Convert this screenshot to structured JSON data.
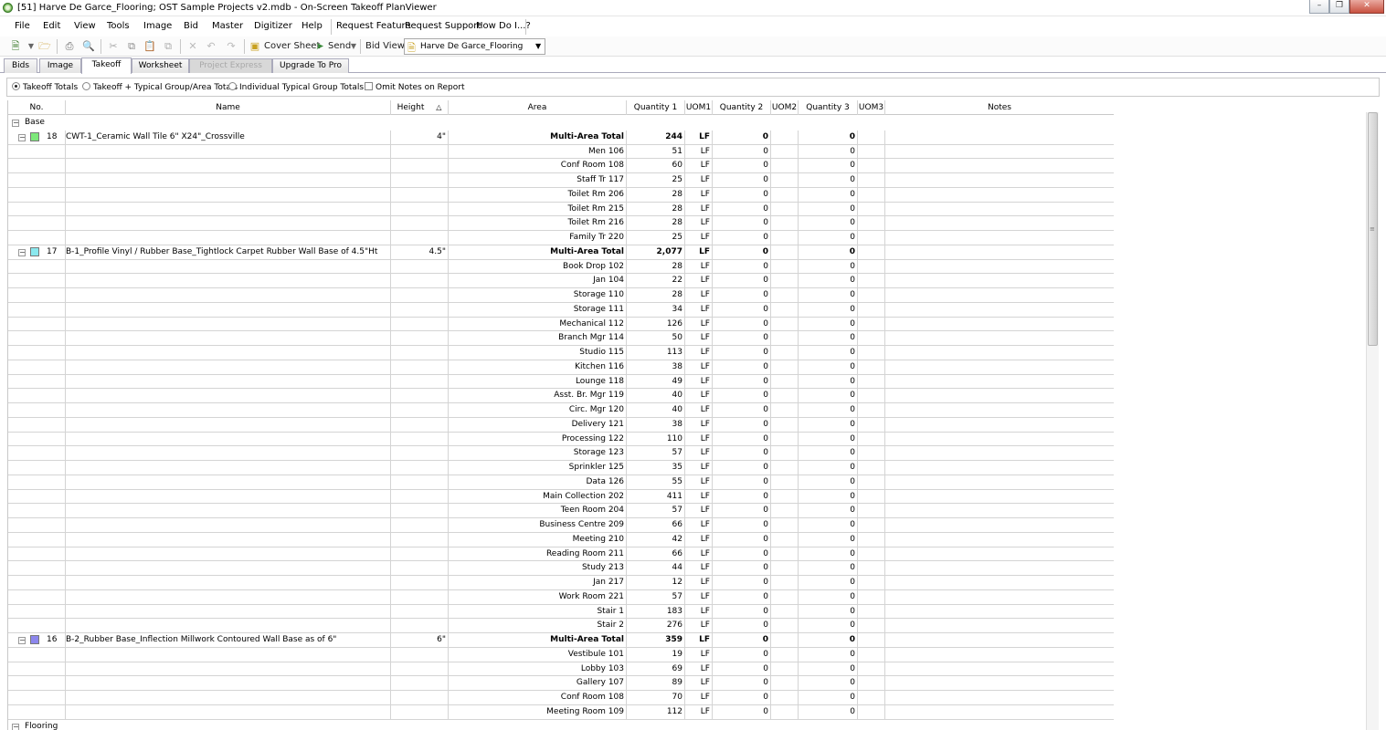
{
  "window": {
    "title": "[51] Harve De Garce_Flooring; OST Sample Projects v2.mdb - On-Screen Takeoff PlanViewer"
  },
  "menu": [
    "File",
    "Edit",
    "View",
    "Tools",
    "Image",
    "Bid",
    "Master",
    "Digitizer",
    "Help",
    "Request Feature",
    "Request Support",
    "How Do I...?"
  ],
  "toolbar": {
    "cover_sheet": "Cover Sheet",
    "send": "Send",
    "bid_view_label": "Bid View",
    "bid_view_value": "Harve De Garce_Flooring"
  },
  "tabs": [
    "Bids",
    "Image",
    "Takeoff",
    "Worksheet",
    "Project Express",
    "Upgrade To Pro"
  ],
  "options": {
    "takeoff_totals": "Takeoff Totals",
    "typical_group": "Takeoff + Typical Group/Area Totals",
    "individual_group": "Individual Typical Group Totals",
    "omit_notes": "Omit Notes on Report"
  },
  "columns": {
    "no": "No.",
    "name": "Name",
    "height": "Height",
    "area": "Area",
    "qty1": "Quantity 1",
    "uom1": "UOM1",
    "qty2": "Quantity 2",
    "uom2": "UOM2",
    "qty3": "Quantity 3",
    "uom3": "UOM3",
    "notes": "Notes"
  },
  "groups": {
    "base": "Base",
    "flooring": "Flooring"
  },
  "items": [
    {
      "no": "18",
      "color": "#7de87a",
      "name": "CWT-1_Ceramic Wall Tile 6\" X24\"_Crossville",
      "height": "4\"",
      "total_label": "Multi-Area Total",
      "total_q1": "244",
      "uom": "LF",
      "total_q2": "0",
      "total_q3": "0",
      "areas": [
        [
          "Men 106",
          "51"
        ],
        [
          "Conf Room 108",
          "60"
        ],
        [
          "Staff Tr 117",
          "25"
        ],
        [
          "Toilet Rm 206",
          "28"
        ],
        [
          "Toilet Rm 215",
          "28"
        ],
        [
          "Toilet Rm 216",
          "28"
        ],
        [
          "Family Tr 220",
          "25"
        ]
      ]
    },
    {
      "no": "17",
      "color": "#8ae8ee",
      "name": "B-1_Profile Vinyl / Rubber Base_Tightlock Carpet Rubber Wall Base of 4.5\"Ht",
      "height": "4.5\"",
      "total_label": "Multi-Area Total",
      "total_q1": "2,077",
      "uom": "LF",
      "total_q2": "0",
      "total_q3": "0",
      "areas": [
        [
          "Book Drop 102",
          "28"
        ],
        [
          "Jan 104",
          "22"
        ],
        [
          "Storage 110",
          "28"
        ],
        [
          "Storage 111",
          "34"
        ],
        [
          "Mechanical 112",
          "126"
        ],
        [
          "Branch Mgr 114",
          "50"
        ],
        [
          "Studio 115",
          "113"
        ],
        [
          "Kitchen 116",
          "38"
        ],
        [
          "Lounge 118",
          "49"
        ],
        [
          "Asst. Br. Mgr 119",
          "40"
        ],
        [
          "Circ. Mgr 120",
          "40"
        ],
        [
          "Delivery 121",
          "38"
        ],
        [
          "Processing 122",
          "110"
        ],
        [
          "Storage 123",
          "57"
        ],
        [
          "Sprinkler 125",
          "35"
        ],
        [
          "Data 126",
          "55"
        ],
        [
          "Main Collection 202",
          "411"
        ],
        [
          "Teen Room 204",
          "57"
        ],
        [
          "Business Centre 209",
          "66"
        ],
        [
          "Meeting 210",
          "42"
        ],
        [
          "Reading Room 211",
          "66"
        ],
        [
          "Study 213",
          "44"
        ],
        [
          "Jan 217",
          "12"
        ],
        [
          "Work Room 221",
          "57"
        ],
        [
          "Stair 1",
          "183"
        ],
        [
          "Stair 2",
          "276"
        ]
      ]
    },
    {
      "no": "16",
      "color": "#8c86ec",
      "name": "B-2_Rubber Base_Inflection Millwork Contoured Wall Base as of 6\"",
      "height": "6\"",
      "total_label": "Multi-Area Total",
      "total_q1": "359",
      "uom": "LF",
      "total_q2": "0",
      "total_q3": "0",
      "areas": [
        [
          "Vestibule 101",
          "19"
        ],
        [
          "Lobby 103",
          "69"
        ],
        [
          "Gallery 107",
          "89"
        ],
        [
          "Conf Room 108",
          "70"
        ],
        [
          "Meeting Room 109",
          "112"
        ]
      ]
    }
  ],
  "zero": "0"
}
